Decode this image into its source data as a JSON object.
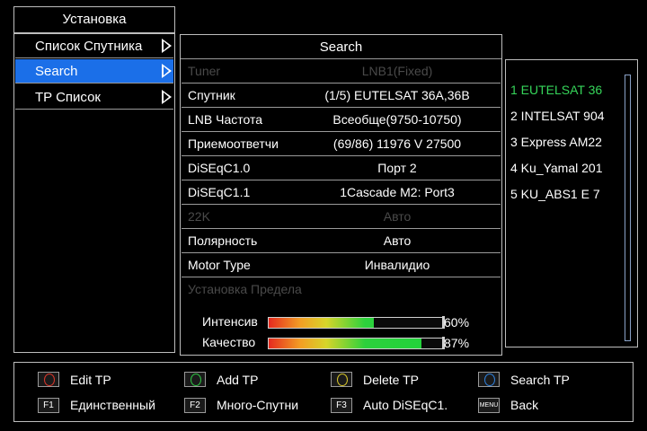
{
  "menu": {
    "title": "Установка",
    "items": [
      {
        "label": "Список Спутника"
      },
      {
        "label": "Search"
      },
      {
        "label": "TP Список"
      }
    ]
  },
  "panel": {
    "title": "Search",
    "rows": [
      {
        "key": "Tuner",
        "value": "LNB1(Fixed)"
      },
      {
        "key": "Спутник",
        "value": "(1/5) EUTELSAT 36A,36B"
      },
      {
        "key": "LNB Частота",
        "value": "Всеобще(9750-10750)"
      },
      {
        "key": "Приемоответчи",
        "value": "(69/86) 11976 V 27500"
      },
      {
        "key": "DiSEqC1.0",
        "value": "Порт 2"
      },
      {
        "key": "DiSEqC1.1",
        "value": "1Cascade M2: Port3"
      },
      {
        "key": "22K",
        "value": "Авто"
      },
      {
        "key": "Полярность",
        "value": "Авто"
      },
      {
        "key": "Motor Type",
        "value": "Инвалидио"
      },
      {
        "key": "Установка Предела",
        "value": ""
      }
    ],
    "signal": {
      "intensity_label": "Интенсив",
      "intensity_pct": 60,
      "intensity_text": "60%",
      "quality_label": "Качество",
      "quality_pct": 87,
      "quality_text": "87%"
    }
  },
  "satellites": [
    {
      "label": "1  EUTELSAT 36"
    },
    {
      "label": "2  INTELSAT 904"
    },
    {
      "label": "3  Express AM22"
    },
    {
      "label": "4  Ku_Yamal 201"
    },
    {
      "label": "5  KU_ABS1   E 7"
    }
  ],
  "help": {
    "edit_tp": "Edit TP",
    "add_tp": "Add TP",
    "delete_tp": "Delete TP",
    "search_tp": "Search TP",
    "f1_key": "F1",
    "f1_label": "Единственный",
    "f2_key": "F2",
    "f2_label": "Много-Спутни",
    "f3_key": "F3",
    "f3_label": "Auto DiSEqC1.",
    "menu_key": "MENU",
    "back": "Back"
  },
  "colors": {
    "selected_bg": "#1b6fe8",
    "active_sat": "#36d65a",
    "red_button": "#d9362b",
    "green_button": "#2ec443",
    "yellow_button": "#d6c52b",
    "blue_button": "#2f7fd9"
  }
}
